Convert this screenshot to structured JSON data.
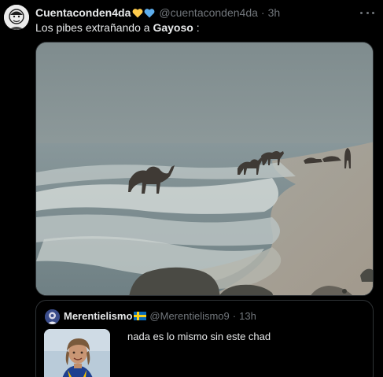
{
  "post": {
    "author": {
      "display_name": "Cuentaconden4da",
      "handle": "@cuentaconden4da",
      "emoji_icons": [
        "yellow-heart-icon",
        "blue-heart-icon"
      ]
    },
    "time": "3h",
    "separator": "·",
    "text_prefix": "Los pibes extrañando a ",
    "text_bold": "Gayoso",
    "text_suffix": " :",
    "more_icon": "more-horizontal-icon"
  },
  "quote": {
    "author": {
      "display_name": "Merentielismo",
      "handle": "@Merentielismo9",
      "flag_icon": "sweden-flag-icon"
    },
    "time": "13h",
    "separator": "·",
    "text": "nada es lo mismo sin este chad"
  },
  "colors": {
    "background": "#000000",
    "primary_text": "#e7e9ea",
    "secondary_text": "#71767b",
    "border": "#2f3336"
  }
}
